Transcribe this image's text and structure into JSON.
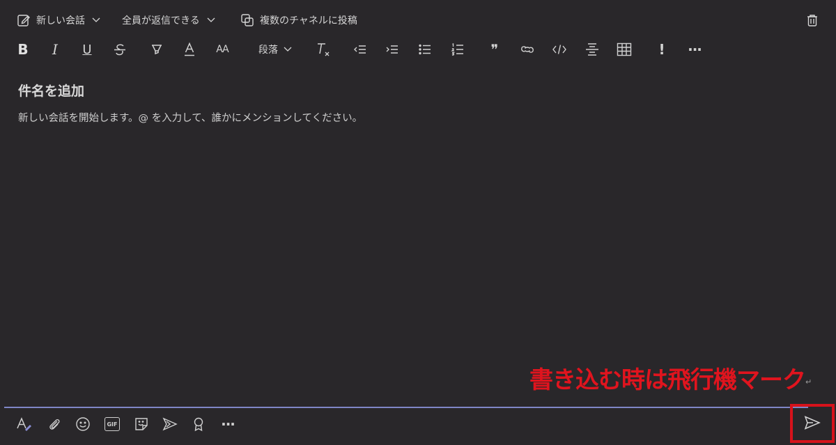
{
  "top_bar": {
    "new_conversation_label": "新しい会話",
    "reply_permission_label": "全員が返信できる",
    "post_multiple_channels_label": "複数のチャネルに投稿",
    "icons": [
      "compose-icon",
      "chevron-down-icon",
      "copy-channels-icon",
      "trash-icon"
    ]
  },
  "format_toolbar": {
    "bold": "B",
    "italic": "I",
    "underline": "U",
    "font_size": "AA",
    "paragraph_label": "段落",
    "quote": "❞",
    "important": "!",
    "more": "···",
    "icons": [
      "bold-icon",
      "italic-icon",
      "underline-icon",
      "strikethrough-icon",
      "highlight-icon",
      "font-color-icon",
      "font-size-icon",
      "paragraph-dropdown",
      "clear-formatting-icon",
      "decrease-indent-icon",
      "increase-indent-icon",
      "bulleted-list-icon",
      "numbered-list-icon",
      "quote-icon",
      "link-icon",
      "code-snippet-icon",
      "horizontal-rule-icon",
      "table-icon",
      "mark-important-icon",
      "more-options-icon"
    ]
  },
  "editor": {
    "subject_placeholder": "件名を追加",
    "body_placeholder": "新しい会話を開始します。@ を入力して、誰かにメンションしてください。"
  },
  "annotation": {
    "text": "書き込む時は飛行機マーク",
    "return_mark": "↵",
    "color": "#e0141e"
  },
  "bottom_bar": {
    "gif_label": "GIF",
    "more": "···",
    "icons": [
      "format-icon",
      "attach-icon",
      "emoji-icon",
      "gif-icon",
      "sticker-icon",
      "stream-icon",
      "praise-icon",
      "more-options-icon",
      "send-icon"
    ]
  },
  "colors": {
    "background": "#29272a",
    "divider": "#7f86c6",
    "highlight": "#d6121b"
  }
}
